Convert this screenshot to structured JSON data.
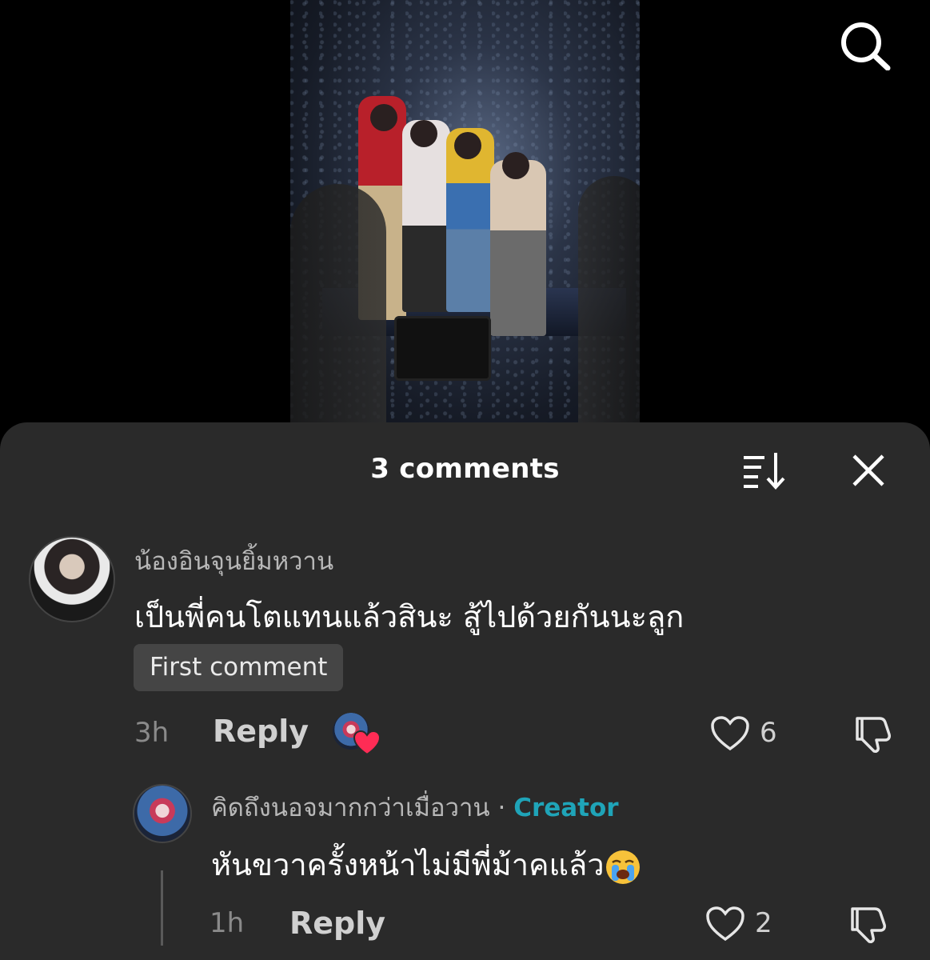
{
  "sheet": {
    "title": "3 comments"
  },
  "icons": {
    "search": "search-icon",
    "sort": "sort-icon",
    "close": "close-icon",
    "heart": "heart-icon",
    "dislike": "dislike-icon"
  },
  "colors": {
    "sheet_bg": "#2a2a2a",
    "creator_accent": "#1fa4b8",
    "liked_heart": "#fe2c55"
  },
  "comments": [
    {
      "username": "น้องอินจุนยิ้มหวาน",
      "text": "เป็นพี่คนโตแทนแล้วสินะ สู้ไปด้วยกันนะลูก",
      "badge": "First comment",
      "time": "3h",
      "reply_label": "Reply",
      "likes": "6",
      "liked_by_creator": true
    },
    {
      "username": "คิดถึงนอจมากกว่าเมื่อวาน",
      "separator": "·",
      "creator_label": "Creator",
      "text": "หันขวาครั้งหน้าไม่มีพี่ม้าคแล้ว",
      "emoji": "crying-face-emoji",
      "time": "1h",
      "reply_label": "Reply",
      "likes": "2"
    }
  ]
}
